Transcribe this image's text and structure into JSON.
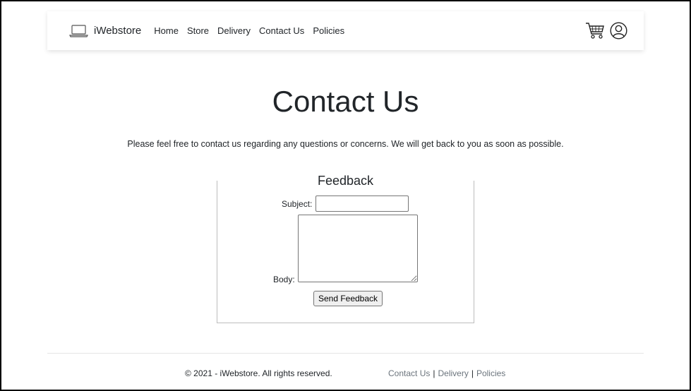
{
  "navbar": {
    "brand": "iWebstore",
    "brand_icon": "laptop-icon",
    "links": [
      "Home",
      "Store",
      "Delivery",
      "Contact Us",
      "Policies"
    ],
    "icons": [
      "cart-icon",
      "user-icon"
    ]
  },
  "main": {
    "title": "Contact Us",
    "intro": "Please feel free to contact us regarding any questions or concerns. We will get back to you as soon as possible."
  },
  "feedback": {
    "legend": "Feedback",
    "subject_label": "Subject:",
    "subject_value": "",
    "body_label": "Body:",
    "body_value": "",
    "send_label": "Send Feedback"
  },
  "footer": {
    "copyright": "© 2021 - iWebstore. All rights reserved.",
    "links": [
      "Contact Us",
      "Delivery",
      "Policies"
    ],
    "separator": "|"
  },
  "colors": {
    "text": "#212529",
    "muted_link": "#6c757d",
    "border": "#bdbdbd"
  }
}
